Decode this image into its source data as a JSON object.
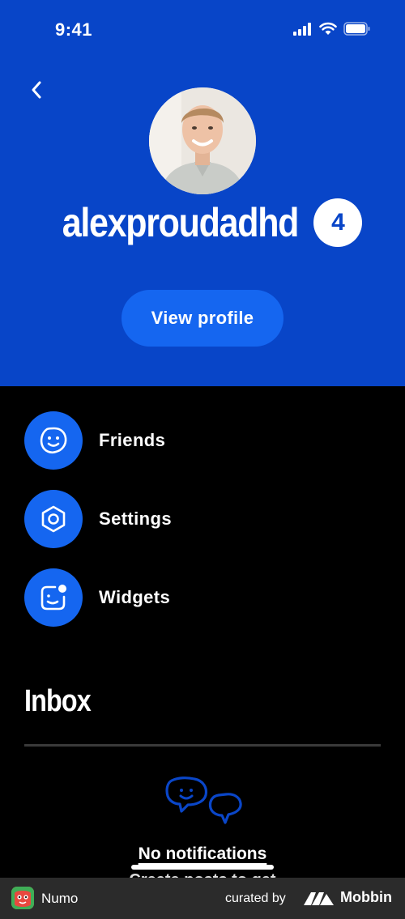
{
  "status_bar": {
    "time": "9:41"
  },
  "profile": {
    "username": "alexproudadhd",
    "badge_count": "4",
    "view_profile_label": "View profile"
  },
  "menu": {
    "items": [
      {
        "label": "Friends",
        "icon": "smiley-icon"
      },
      {
        "label": "Settings",
        "icon": "gear-icon"
      },
      {
        "label": "Widgets",
        "icon": "widget-icon"
      }
    ]
  },
  "inbox": {
    "title": "Inbox",
    "empty_title": "No notifications",
    "empty_subtitle": "Create posts to get"
  },
  "footer": {
    "app_name": "Numo",
    "curated_by": "curated by",
    "brand": "Mobbin"
  },
  "colors": {
    "hero_blue": "#0845c8",
    "accent_blue": "#1566f0",
    "background": "#000000"
  }
}
